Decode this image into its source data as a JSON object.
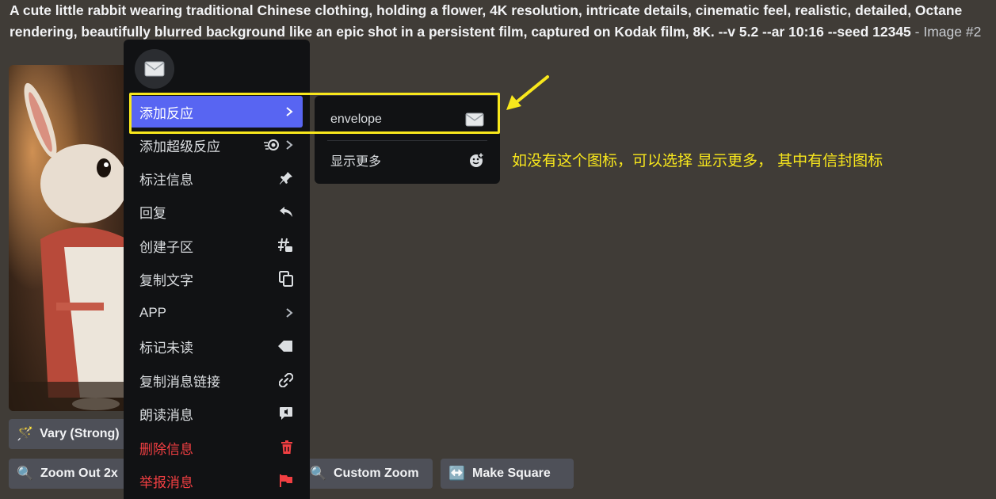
{
  "prompt": {
    "text": "A cute little rabbit wearing traditional Chinese clothing, holding a flower, 4K resolution, intricate details, cinematic feel, realistic, detailed, Octane rendering, beautifully blurred background like an epic shot in a persistent film, captured on Kodak film, 8K. --v 5.2 --ar 10:16 --seed 12345",
    "suffix": " - Image #2"
  },
  "buttons": {
    "vary_strong": "Vary (Strong)",
    "zoom_out": "Zoom Out 2x",
    "custom_zoom": "Custom Zoom",
    "make_square": "Make Square"
  },
  "menu": {
    "quick_reaction_icon": "envelope-icon",
    "items": [
      {
        "label": "添加反应",
        "icon": "chevron-right-icon"
      },
      {
        "label": "添加超级反应",
        "icon": "super-reaction-icon"
      },
      {
        "label": "标注信息",
        "icon": "pin-icon"
      },
      {
        "label": "回复",
        "icon": "reply-icon"
      },
      {
        "label": "创建子区",
        "icon": "thread-icon"
      },
      {
        "label": "复制文字",
        "icon": "copy-icon"
      },
      {
        "label": "APP",
        "icon": "chevron-right-icon"
      },
      {
        "label": "标记未读",
        "icon": "unread-icon"
      },
      {
        "label": "复制消息链接",
        "icon": "link-icon"
      },
      {
        "label": "朗读消息",
        "icon": "speak-icon"
      },
      {
        "label": "删除信息",
        "icon": "trash-icon"
      },
      {
        "label": "举报消息",
        "icon": "flag-icon"
      }
    ]
  },
  "submenu": {
    "envelope_label": "envelope",
    "show_more_label": "显示更多"
  },
  "annotation": {
    "note": "如没有这个图标，可以选择 显示更多， 其中有信封图标"
  },
  "colors": {
    "accent": "#5865f2",
    "danger": "#f23f42",
    "highlight": "#f8e71c",
    "background": "#403c37",
    "menu_bg": "#111214"
  }
}
